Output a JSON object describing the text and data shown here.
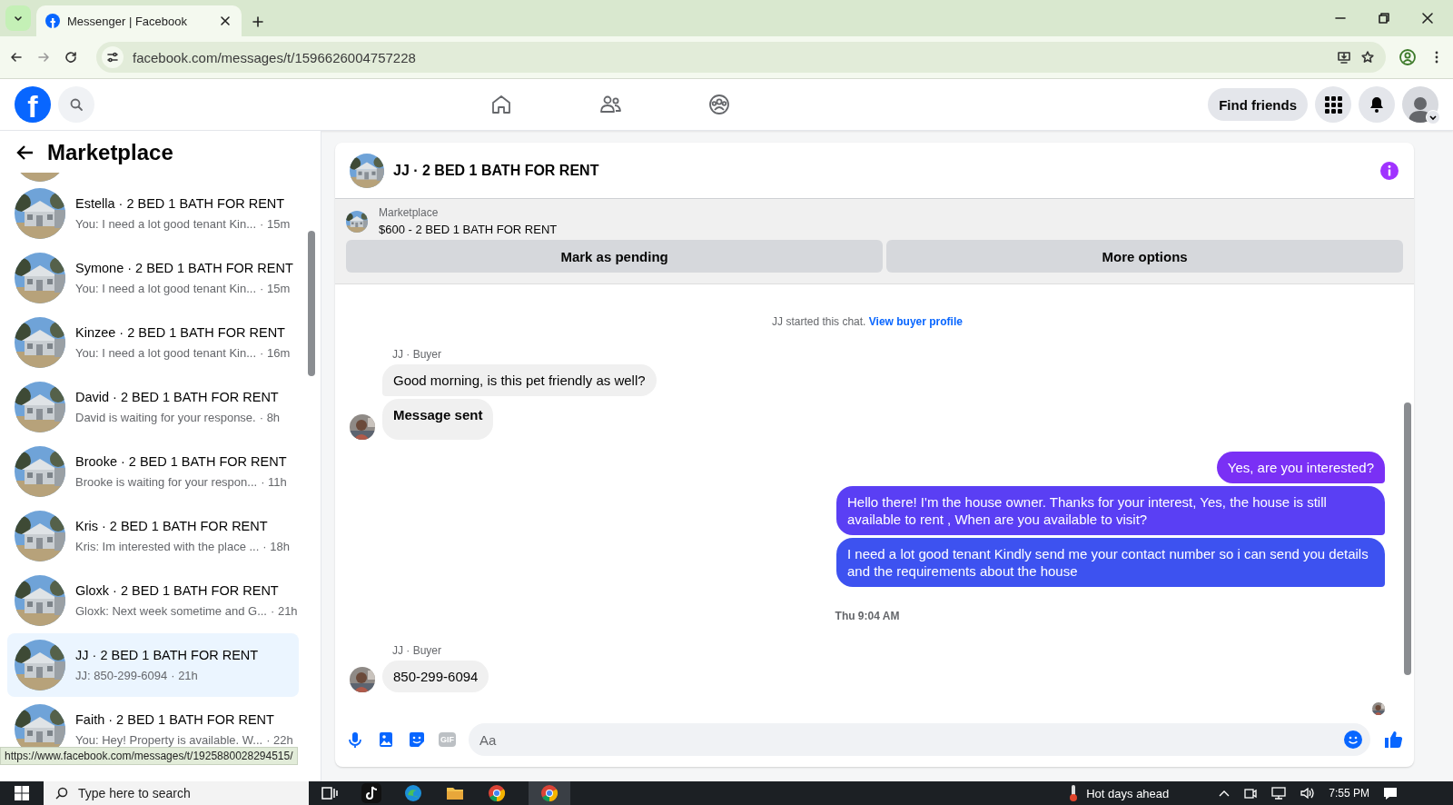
{
  "browser": {
    "tab_title": "Messenger | Facebook",
    "url": "facebook.com/messages/t/1596626004757228",
    "status_url": "https://www.facebook.com/messages/t/1925880028294515/"
  },
  "header": {
    "logo": "f",
    "find_friends": "Find friends"
  },
  "sidebar": {
    "title": "Marketplace",
    "conversations": [
      {
        "title": "Estella · 2 BED 1 BATH FOR RENT",
        "preview": "You: I need a lot good tenant Kin...",
        "time": "· 15m",
        "selected": false
      },
      {
        "title": "Symone · 2 BED 1 BATH FOR RENT",
        "preview": "You: I need a lot good tenant Kin...",
        "time": "· 15m",
        "selected": false
      },
      {
        "title": "Kinzee · 2 BED 1 BATH FOR RENT",
        "preview": "You: I need a lot good tenant Kin...",
        "time": "· 16m",
        "selected": false
      },
      {
        "title": "David · 2 BED 1 BATH FOR RENT",
        "preview": "David is waiting for your response.",
        "time": "· 8h",
        "selected": false
      },
      {
        "title": "Brooke · 2 BED 1 BATH FOR RENT",
        "preview": "Brooke is waiting for your respon...",
        "time": "· 11h",
        "selected": false
      },
      {
        "title": "Kris · 2 BED 1 BATH FOR RENT",
        "preview": "Kris: Im interested with the place ...",
        "time": "· 18h",
        "selected": false
      },
      {
        "title": "Gloxk · 2 BED 1 BATH FOR RENT",
        "preview": "Gloxk: Next week sometime and G...",
        "time": "· 21h",
        "selected": false
      },
      {
        "title": "JJ · 2 BED 1 BATH FOR RENT",
        "preview": "JJ: 850-299-6094",
        "time": "· 21h",
        "selected": true
      },
      {
        "title": "Faith · 2 BED 1 BATH FOR RENT",
        "preview": "You: Hey! Property is available. W...",
        "time": "· 22h",
        "selected": false
      }
    ]
  },
  "chat": {
    "title": "JJ · 2 BED 1 BATH FOR RENT",
    "listing": {
      "label": "Marketplace",
      "name": "$600 - 2 BED 1 BATH FOR RENT",
      "buttons": [
        "Mark as pending",
        "More options"
      ]
    },
    "messages": [
      {
        "kind": "system",
        "text": "JJ started this chat.",
        "link": "View buyer profile"
      },
      {
        "kind": "sender",
        "text": "JJ · Buyer"
      },
      {
        "kind": "incoming",
        "text": "Good morning, is this pet friendly as well?",
        "bold": false,
        "avatar": false
      },
      {
        "kind": "incoming",
        "text": "Message sent",
        "bold": true,
        "avatar": true
      },
      {
        "kind": "outgoing",
        "text": "Yes, are you interested?"
      },
      {
        "kind": "outgoing",
        "text": "Hello there! I'm the house owner. Thanks for your interest, Yes, the house is still available to rent , When are you available to visit?"
      },
      {
        "kind": "outgoing",
        "text": "I need a lot good tenant Kindly send me your contact number so i can send you details and the requirements about the house"
      },
      {
        "kind": "time",
        "text": "Thu 9:04 AM"
      },
      {
        "kind": "sender",
        "text": "JJ · Buyer"
      },
      {
        "kind": "incoming",
        "text": "850-299-6094",
        "bold": false,
        "avatar": true
      },
      {
        "kind": "seen"
      }
    ],
    "composer": {
      "gif_label": "GIF",
      "placeholder": "Aa"
    }
  },
  "taskbar": {
    "search_placeholder": "Type here to search",
    "weather": "Hot days ahead",
    "time": "7:55 PM"
  }
}
